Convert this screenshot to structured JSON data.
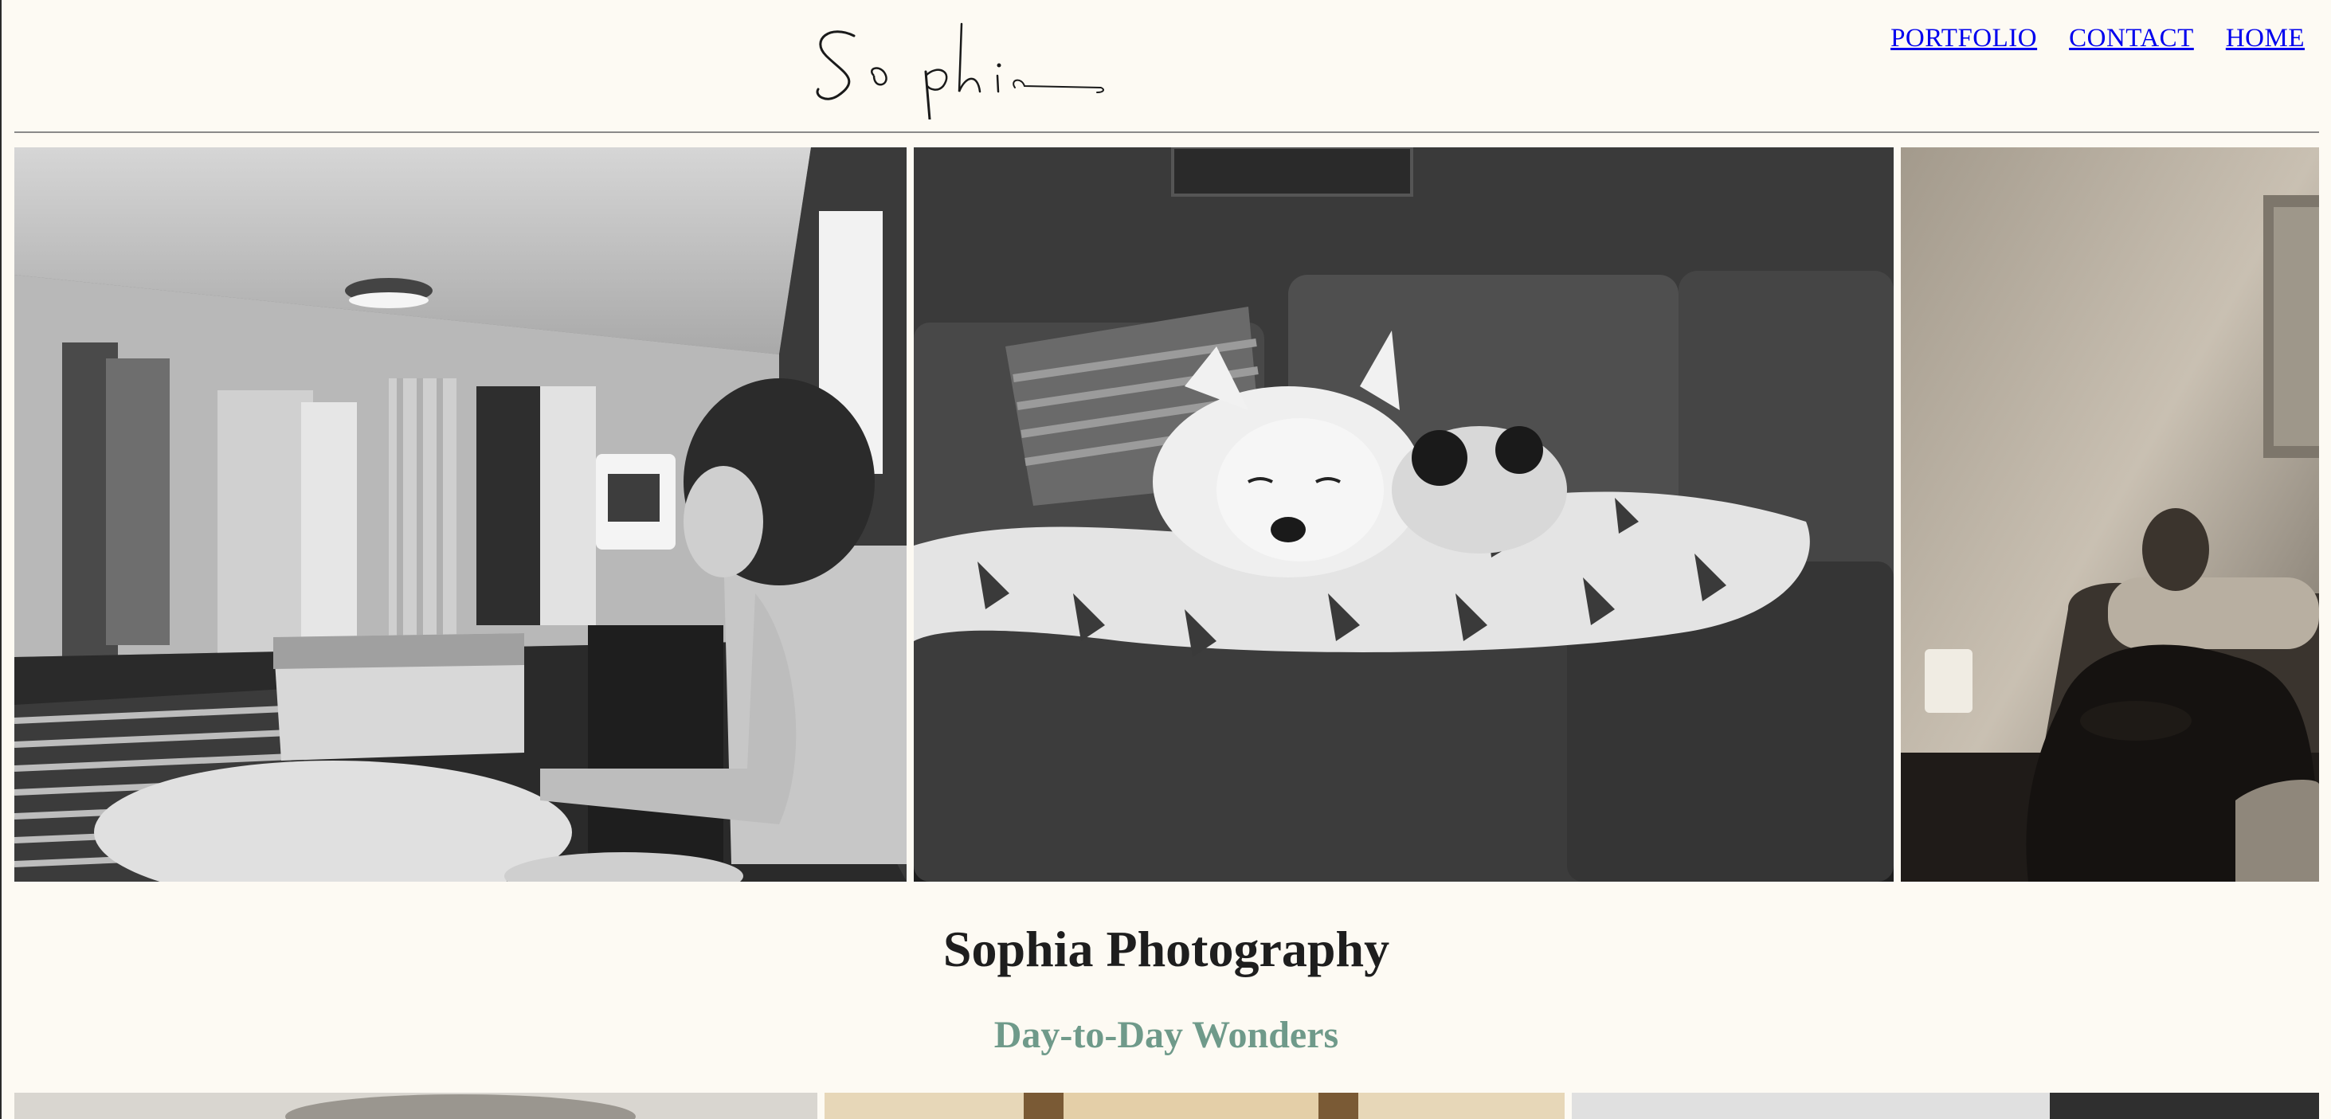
{
  "site": {
    "logo_text": "Sophia"
  },
  "nav": {
    "items": [
      {
        "label": "PORTFOLIO"
      },
      {
        "label": "CONTACT"
      },
      {
        "label": "HOME"
      }
    ]
  },
  "hero": {
    "title": "Sophia Photography",
    "subtitle": "Day-to-Day Wonders"
  },
  "gallery": {
    "photos": [
      {
        "subject": "man drinking from mug in living room",
        "tone": "black-and-white"
      },
      {
        "subject": "small white dog sleeping on couch blanket",
        "tone": "black-and-white"
      },
      {
        "subject": "bald man reading in armchair",
        "tone": "sepia"
      }
    ]
  },
  "colors": {
    "background": "#fdfaf3",
    "link": "#0000ee",
    "title": "#1e1e1e",
    "subtitle": "#6f9a8a"
  }
}
